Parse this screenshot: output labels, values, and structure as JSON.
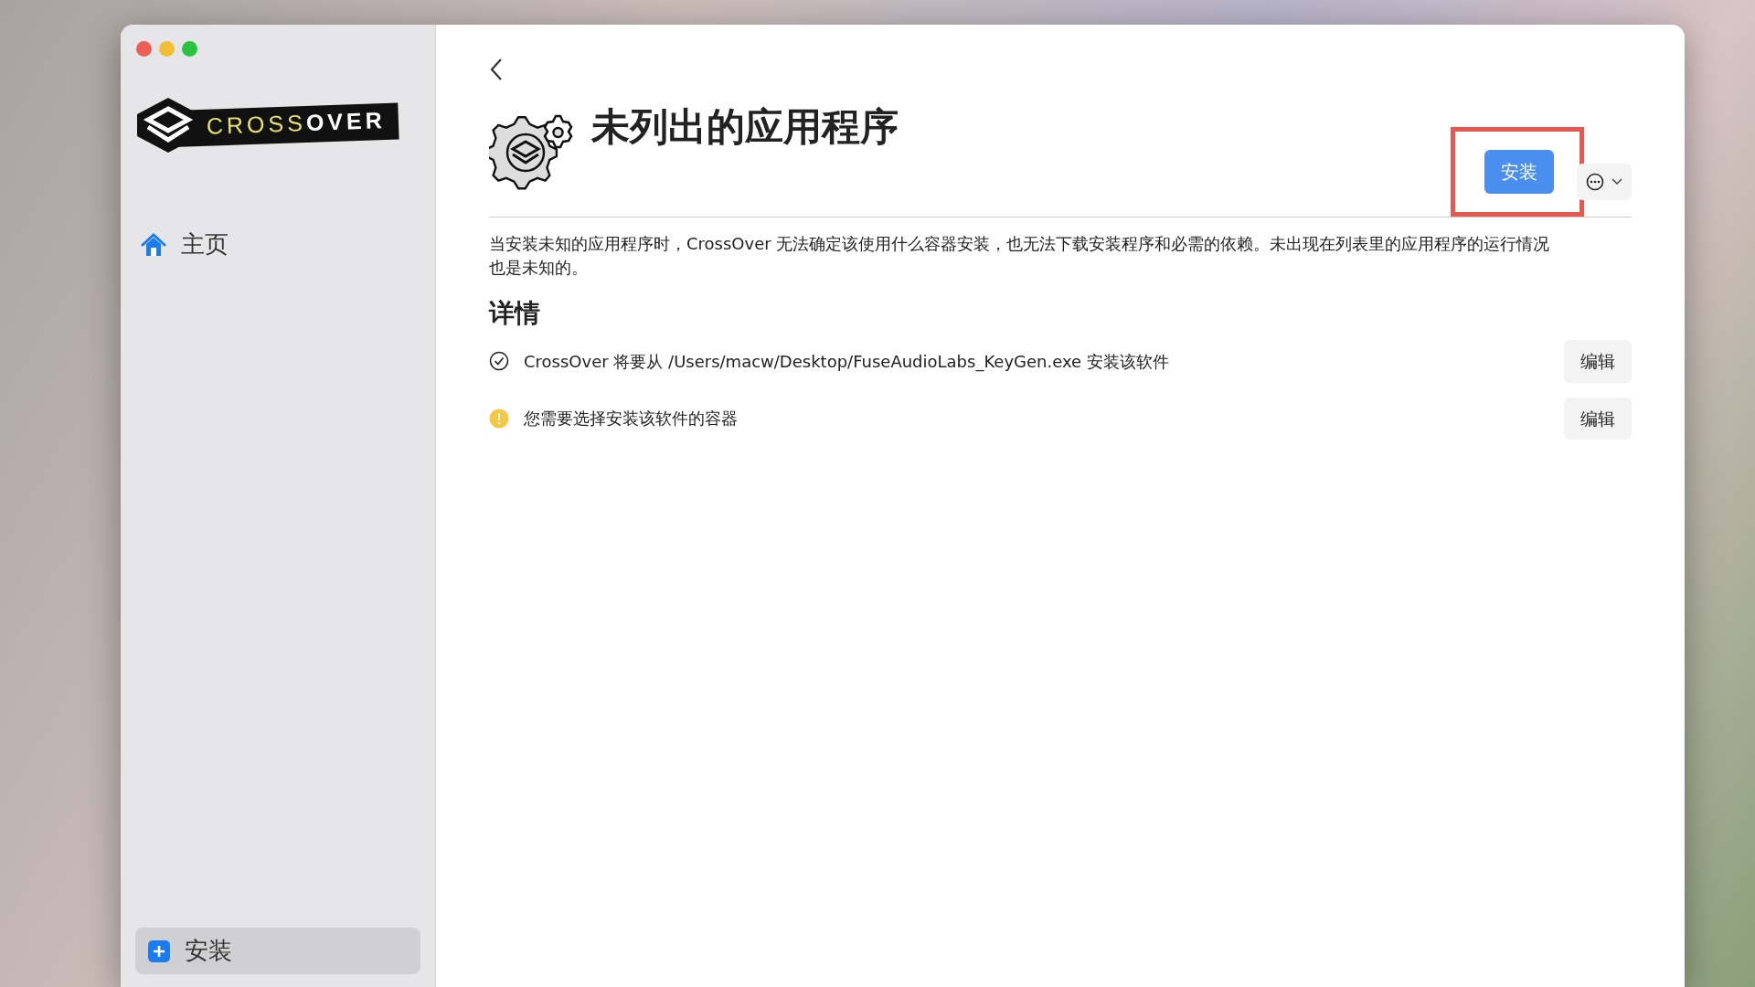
{
  "window": {
    "controls": [
      {
        "color": "#ec5f57"
      },
      {
        "color": "#f4bd36"
      },
      {
        "color": "#27c341"
      }
    ]
  },
  "sidebar": {
    "logo": "CROSS**OVER**",
    "items": [
      {
        "label": "主页",
        "kind": "home",
        "selected": false
      }
    ],
    "footer_button": {
      "label": "安装",
      "selected": true
    }
  },
  "header": {
    "title": "未列出的应用程序",
    "install_button": {
      "label": "安装",
      "highlighted": true
    }
  },
  "description": "当安装未知的应用程序时，CrossOver 无法确定该使用什么容器安装，也无法下载安装程序和必需的依赖。未出现在列表里的应用程序的运行情况也是未知的。",
  "details": {
    "heading": "详情",
    "rows": [
      {
        "kind": "ok",
        "text": "CrossOver 将要从 /Users/macw/Desktop/FuseAudioLabs_KeyGen.exe 安装该软件",
        "button": "编辑"
      },
      {
        "kind": "warning",
        "text": "您需要选择安装该软件的容器",
        "button": "编辑"
      }
    ]
  }
}
